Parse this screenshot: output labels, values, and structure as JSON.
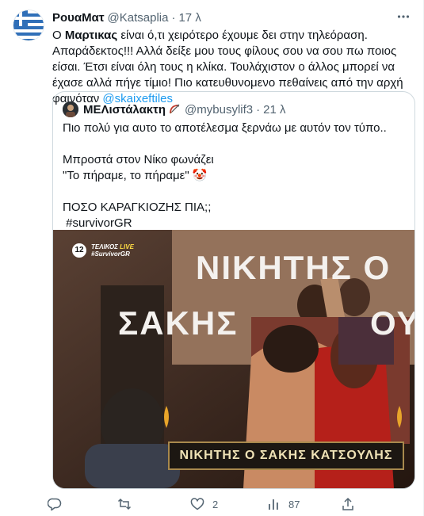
{
  "tweet": {
    "display_name": "ΡουαΜατ",
    "handle": "@Katsaplia",
    "separator": "·",
    "time": "17 λ",
    "text": {
      "part1": "Ο ",
      "bold": "Μαρτικας",
      "part2": " είναι ό,τι χειρότερο έχουμε δει στην τηλεόραση. Απαράδεκτος!!! Αλλά δείξε μου τους φίλους σου να σου πω ποιος είσαι. Έτσι είναι όλη τους η κλίκα. Τουλάχιστον ο άλλος μπορεί να έχασε αλλά πήγε τίμιο! Πιο κατευθυνομενο πεθαίνεις από την αρχή φαινόταν ",
      "mention": "@skaixeftiles"
    },
    "avatar_icon": "greek-flag-icon"
  },
  "quote": {
    "display_name": "ΜΕΛιστάλακτη",
    "name_emoji_icon": "bow-arrow-icon",
    "handle": "@mybusylif3",
    "separator": "·",
    "time": "21 λ",
    "text": "Πιο πολύ για αυτο το αποτέλεσμα ξερνάω με αυτόν τον τύπο..\n\nΜπροστά στον Νίκο φωνάζει\n\"Το πήραμε, το πήραμε\" 🤡\n\nΠΟΣΟ ΚΑΡΑΓΚΙΟΖΗΣ ΠΙΑ;;\n #survivorGR",
    "media": {
      "channel_logo": "12",
      "badge_line1_a": "ΤΕΛΙΚΟΣ",
      "badge_line1_b": "LIVE",
      "badge_line2": "#SurvivorGR",
      "backdrop_line1": "ΝΙΚΗΤΗΣ Ο",
      "backdrop_line2": "ΣΑΚΗΣ",
      "backdrop_line2_tail": "ΟΥ",
      "banner": "ΝΙΚΗΤΗΣ Ο ΣΑΚΗΣ ΚΑΤΣΟΥΛΗΣ"
    }
  },
  "actions": {
    "reply_count": "",
    "retweet_count": "",
    "like_count": "2",
    "views_count": "87"
  },
  "colors": {
    "accent": "#1d9bf0",
    "muted": "#536471",
    "border": "#cfd9de",
    "live_red": "#e8202a"
  }
}
